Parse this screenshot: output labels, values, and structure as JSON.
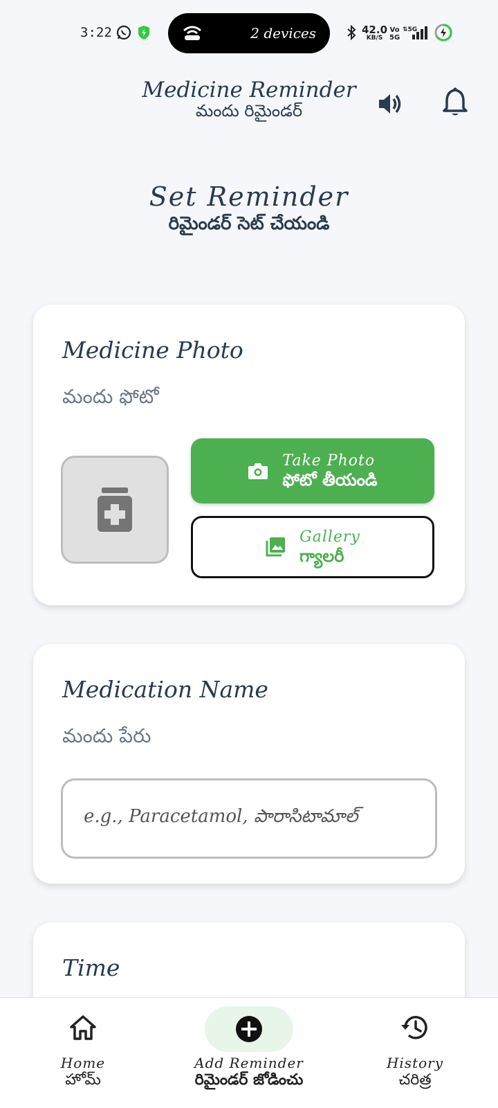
{
  "status_bar": {
    "time": "3:22",
    "hotspot_devices": "2 devices",
    "speed_value": "42.0",
    "speed_unit": "KB/S",
    "volte_top": "Vo",
    "volte_bottom": "5G",
    "network": "5G"
  },
  "header": {
    "title_en": "Medicine Reminder",
    "title_te": "మందు రిమైండర్"
  },
  "page": {
    "heading_en": "Set Reminder",
    "heading_te": "రిమైండర్ సెట్ చేయండి"
  },
  "photo_card": {
    "label_en": "Medicine Photo",
    "label_te": "మందు ఫోటో",
    "take_photo_en": "Take Photo",
    "take_photo_te": "ఫోటో తీయండి",
    "gallery_en": "Gallery",
    "gallery_te": "గ్యాలరీ"
  },
  "name_card": {
    "label_en": "Medication Name",
    "label_te": "మందు పేరు",
    "placeholder": "e.g., Paracetamol, పారాసిటామాల్"
  },
  "time_card": {
    "label_en": "Time"
  },
  "bottom_nav": {
    "home_en": "Home",
    "home_te": "హోమ్",
    "add_en": "Add Reminder",
    "add_te": "రిమైండర్ జోడించు",
    "history_en": "History",
    "history_te": "చరిత్ర"
  },
  "colors": {
    "primary_green": "#4caf50",
    "text_dark": "#2a3a4f",
    "background": "#f5f7fa"
  }
}
